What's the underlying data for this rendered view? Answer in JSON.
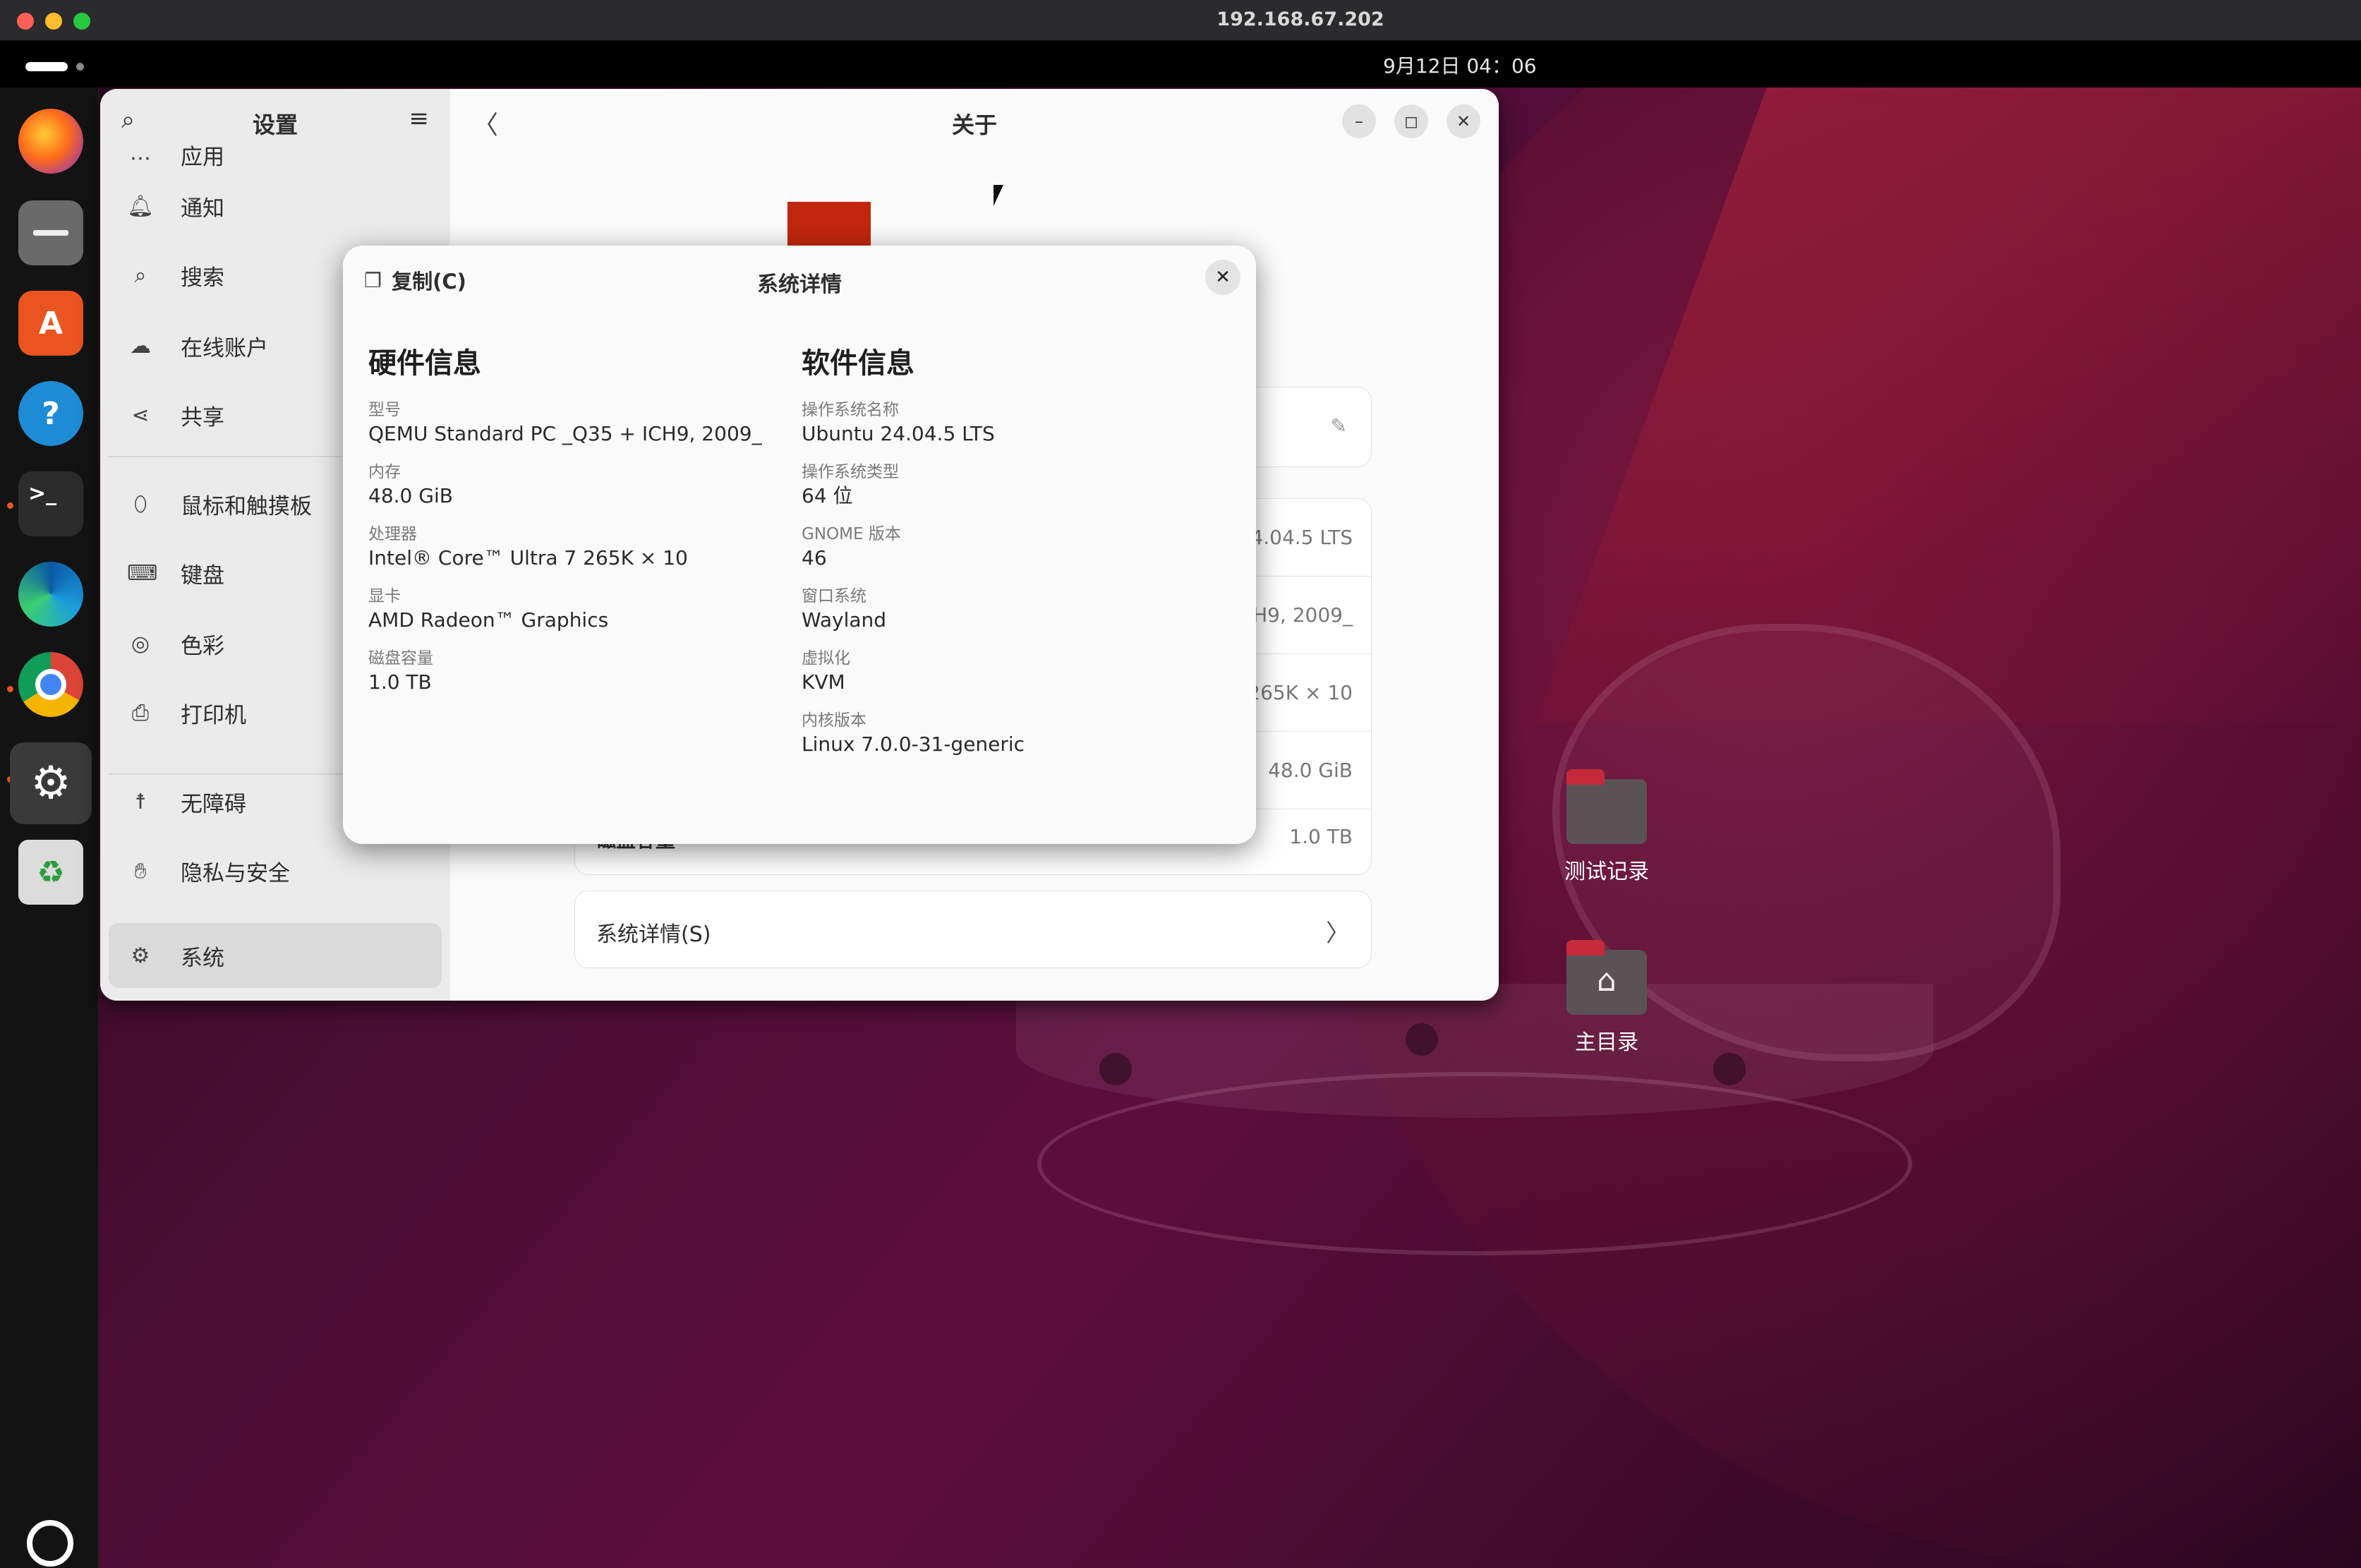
{
  "vnc": {
    "title": "192.168.67.202"
  },
  "panel": {
    "clock": "9月12日  04：06"
  },
  "dock": {
    "items": [
      {
        "name": "firefox-icon",
        "glyph": "",
        "color": "#ff6a1a"
      },
      {
        "name": "files-icon",
        "glyph": "",
        "color": "#6a6a6a"
      },
      {
        "name": "app-center-icon",
        "glyph": "A",
        "color": "#e95420"
      },
      {
        "name": "help-icon",
        "glyph": "?",
        "color": "#1e8bd6"
      },
      {
        "name": "terminal-icon",
        "glyph": ">_",
        "color": "#2c2c2c"
      },
      {
        "name": "edge-icon",
        "glyph": "",
        "color": "#1b9ede"
      },
      {
        "name": "chrome-icon",
        "glyph": "",
        "color": "#db4437"
      },
      {
        "name": "settings-icon",
        "glyph": "⚙",
        "color": "#555555"
      },
      {
        "name": "trash-icon",
        "glyph": "♻",
        "color": "#dcdcdc"
      }
    ],
    "ubuntu_logo": "ubuntu-logo-icon"
  },
  "settings": {
    "sidebar_title": "设置",
    "main_title": "关于",
    "items": [
      {
        "label": "应用",
        "icon": "apps-icon"
      },
      {
        "label": "通知",
        "icon": "bell-icon"
      },
      {
        "label": "搜索",
        "icon": "search-icon"
      },
      {
        "label": "在线账户",
        "icon": "cloud-icon"
      },
      {
        "label": "共享",
        "icon": "share-icon"
      },
      {
        "label": "鼠标和触摸板",
        "icon": "mouse-icon"
      },
      {
        "label": "键盘",
        "icon": "keyboard-icon"
      },
      {
        "label": "色彩",
        "icon": "color-icon"
      },
      {
        "label": "打印机",
        "icon": "printer-icon"
      },
      {
        "label": "无障碍",
        "icon": "accessibility-icon"
      },
      {
        "label": "隐私与安全",
        "icon": "hand-icon"
      },
      {
        "label": "系统",
        "icon": "gear-icon"
      }
    ],
    "about_rows": [
      {
        "value": "24.04.5 LTS"
      },
      {
        "value": "CH9, 2009_"
      },
      {
        "value": "265K × 10"
      },
      {
        "value": "48.0 GiB"
      },
      {
        "key": "磁盘容量",
        "value": "1.0 TB"
      }
    ],
    "system_details_label": "系统详情(S)"
  },
  "dialog": {
    "copy_label": "复制(C)",
    "title": "系统详情",
    "hardware": {
      "heading": "硬件信息",
      "fields": [
        {
          "key": "型号",
          "value": "QEMU Standard PC _Q35 + ICH9, 2009_"
        },
        {
          "key": "内存",
          "value": "48.0 GiB"
        },
        {
          "key": "处理器",
          "value": "Intel® Core™ Ultra 7 265K × 10"
        },
        {
          "key": "显卡",
          "value": "AMD Radeon™ Graphics"
        },
        {
          "key": "磁盘容量",
          "value": "1.0 TB"
        }
      ]
    },
    "software": {
      "heading": "软件信息",
      "fields": [
        {
          "key": "操作系统名称",
          "value": "Ubuntu 24.04.5 LTS"
        },
        {
          "key": "操作系统类型",
          "value": "64 位"
        },
        {
          "key": "GNOME 版本",
          "value": "46"
        },
        {
          "key": "窗口系统",
          "value": "Wayland"
        },
        {
          "key": "虚拟化",
          "value": "KVM"
        },
        {
          "key": "内核版本",
          "value": "Linux 7.0.0-31-generic"
        }
      ]
    }
  },
  "desktop_icons": [
    {
      "label": "测试记录",
      "icon": "folder-icon"
    },
    {
      "label": "主目录",
      "icon": "home-folder-icon"
    }
  ]
}
